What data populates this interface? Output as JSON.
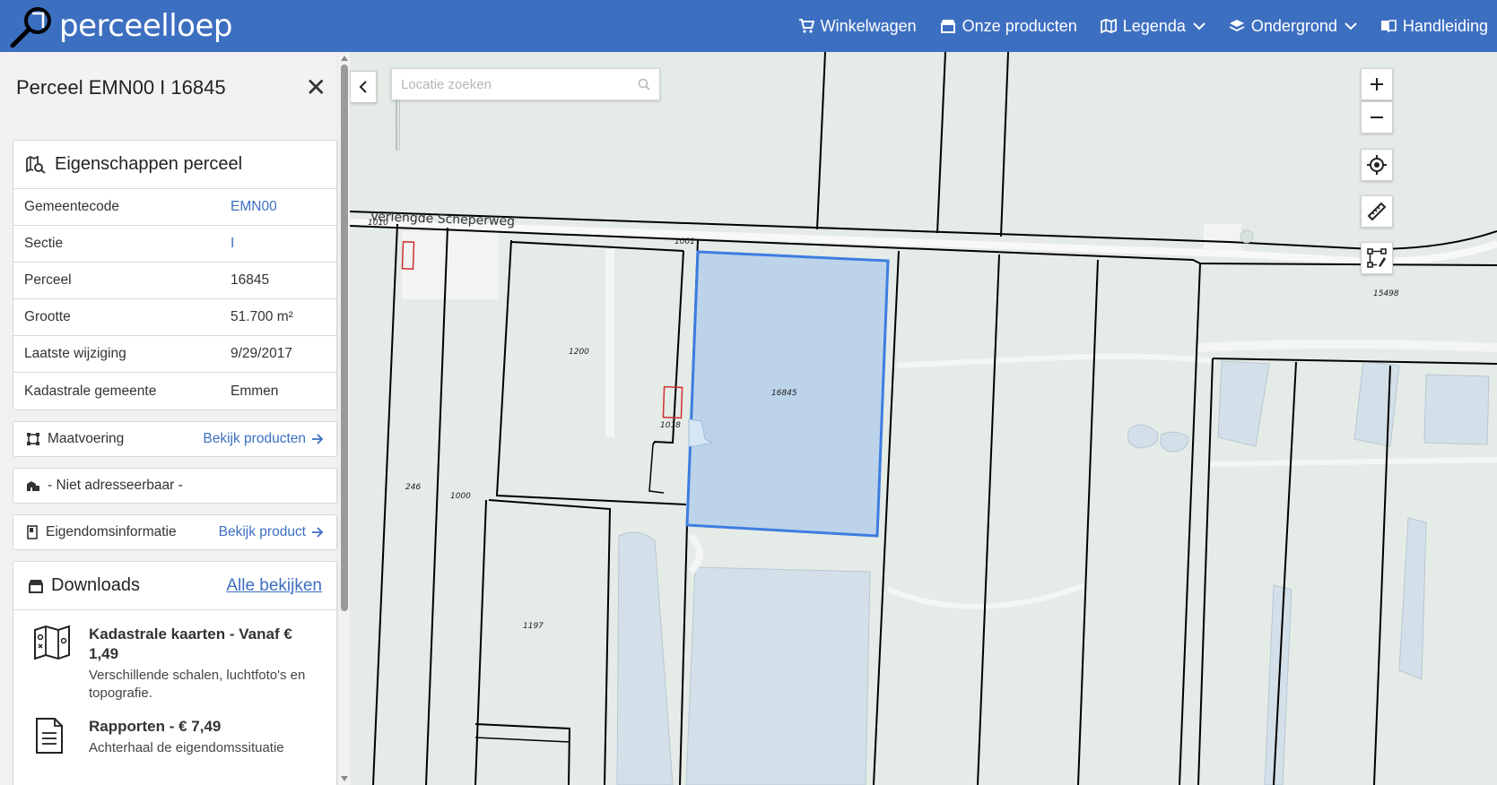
{
  "brand": {
    "name": "perceelloep"
  },
  "nav": [
    {
      "label": "Winkelwagen",
      "icon": "cart-icon"
    },
    {
      "label": "Onze producten",
      "icon": "store-icon"
    },
    {
      "label": "Legenda",
      "icon": "map-icon",
      "dropdown": true
    },
    {
      "label": "Ondergrond",
      "icon": "layers-icon",
      "dropdown": true
    },
    {
      "label": "Handleiding",
      "icon": "book-icon"
    }
  ],
  "sidebar": {
    "title": "Perceel EMN00 I 16845",
    "properties": {
      "heading": "Eigenschappen perceel",
      "rows": [
        {
          "key": "Gemeentecode",
          "value": "EMN00"
        },
        {
          "key": "Sectie",
          "value": "I"
        },
        {
          "key": "Perceel",
          "value": "16845"
        },
        {
          "key": "Grootte",
          "value": "51.700 m²"
        },
        {
          "key": "Laatste wijziging",
          "value": "9/29/2017"
        },
        {
          "key": "Kadastrale gemeente",
          "value": "Emmen"
        }
      ]
    },
    "maatvoering": {
      "label": "Maatvoering",
      "link": "Bekijk producten"
    },
    "address": {
      "label": "- Niet adresseerbaar -"
    },
    "eigendom": {
      "label": "Eigendomsinformatie",
      "link": "Bekijk product"
    },
    "downloads": {
      "heading": "Downloads",
      "all_link": "Alle bekijken",
      "items": [
        {
          "name": "Kadastrale kaarten - Vanaf € 1,49",
          "desc": "Verschillende schalen, luchtfoto's en topografie.",
          "icon": "folded-map-icon"
        },
        {
          "name": "Rapporten - € 7,49",
          "desc": "Achterhaal de eigendomssituatie",
          "icon": "document-icon"
        }
      ]
    }
  },
  "map": {
    "search_placeholder": "Locatie zoeken",
    "road_name": "Verlengde Scheperweg",
    "selected_parcel_color": "#3d7de0",
    "plot_labels": {
      "p1010": "1010",
      "p1001": "1001",
      "p1200": "1200",
      "p16845": "16845",
      "p1018": "1018",
      "p246": "246",
      "p1000": "1000",
      "p1197": "1197",
      "p15498": "15498"
    }
  },
  "colors": {
    "topbar": "#3d6fc1",
    "link": "#3d6fc1",
    "map_ground": "#e5ebe6",
    "water": "#d3e0ea"
  }
}
